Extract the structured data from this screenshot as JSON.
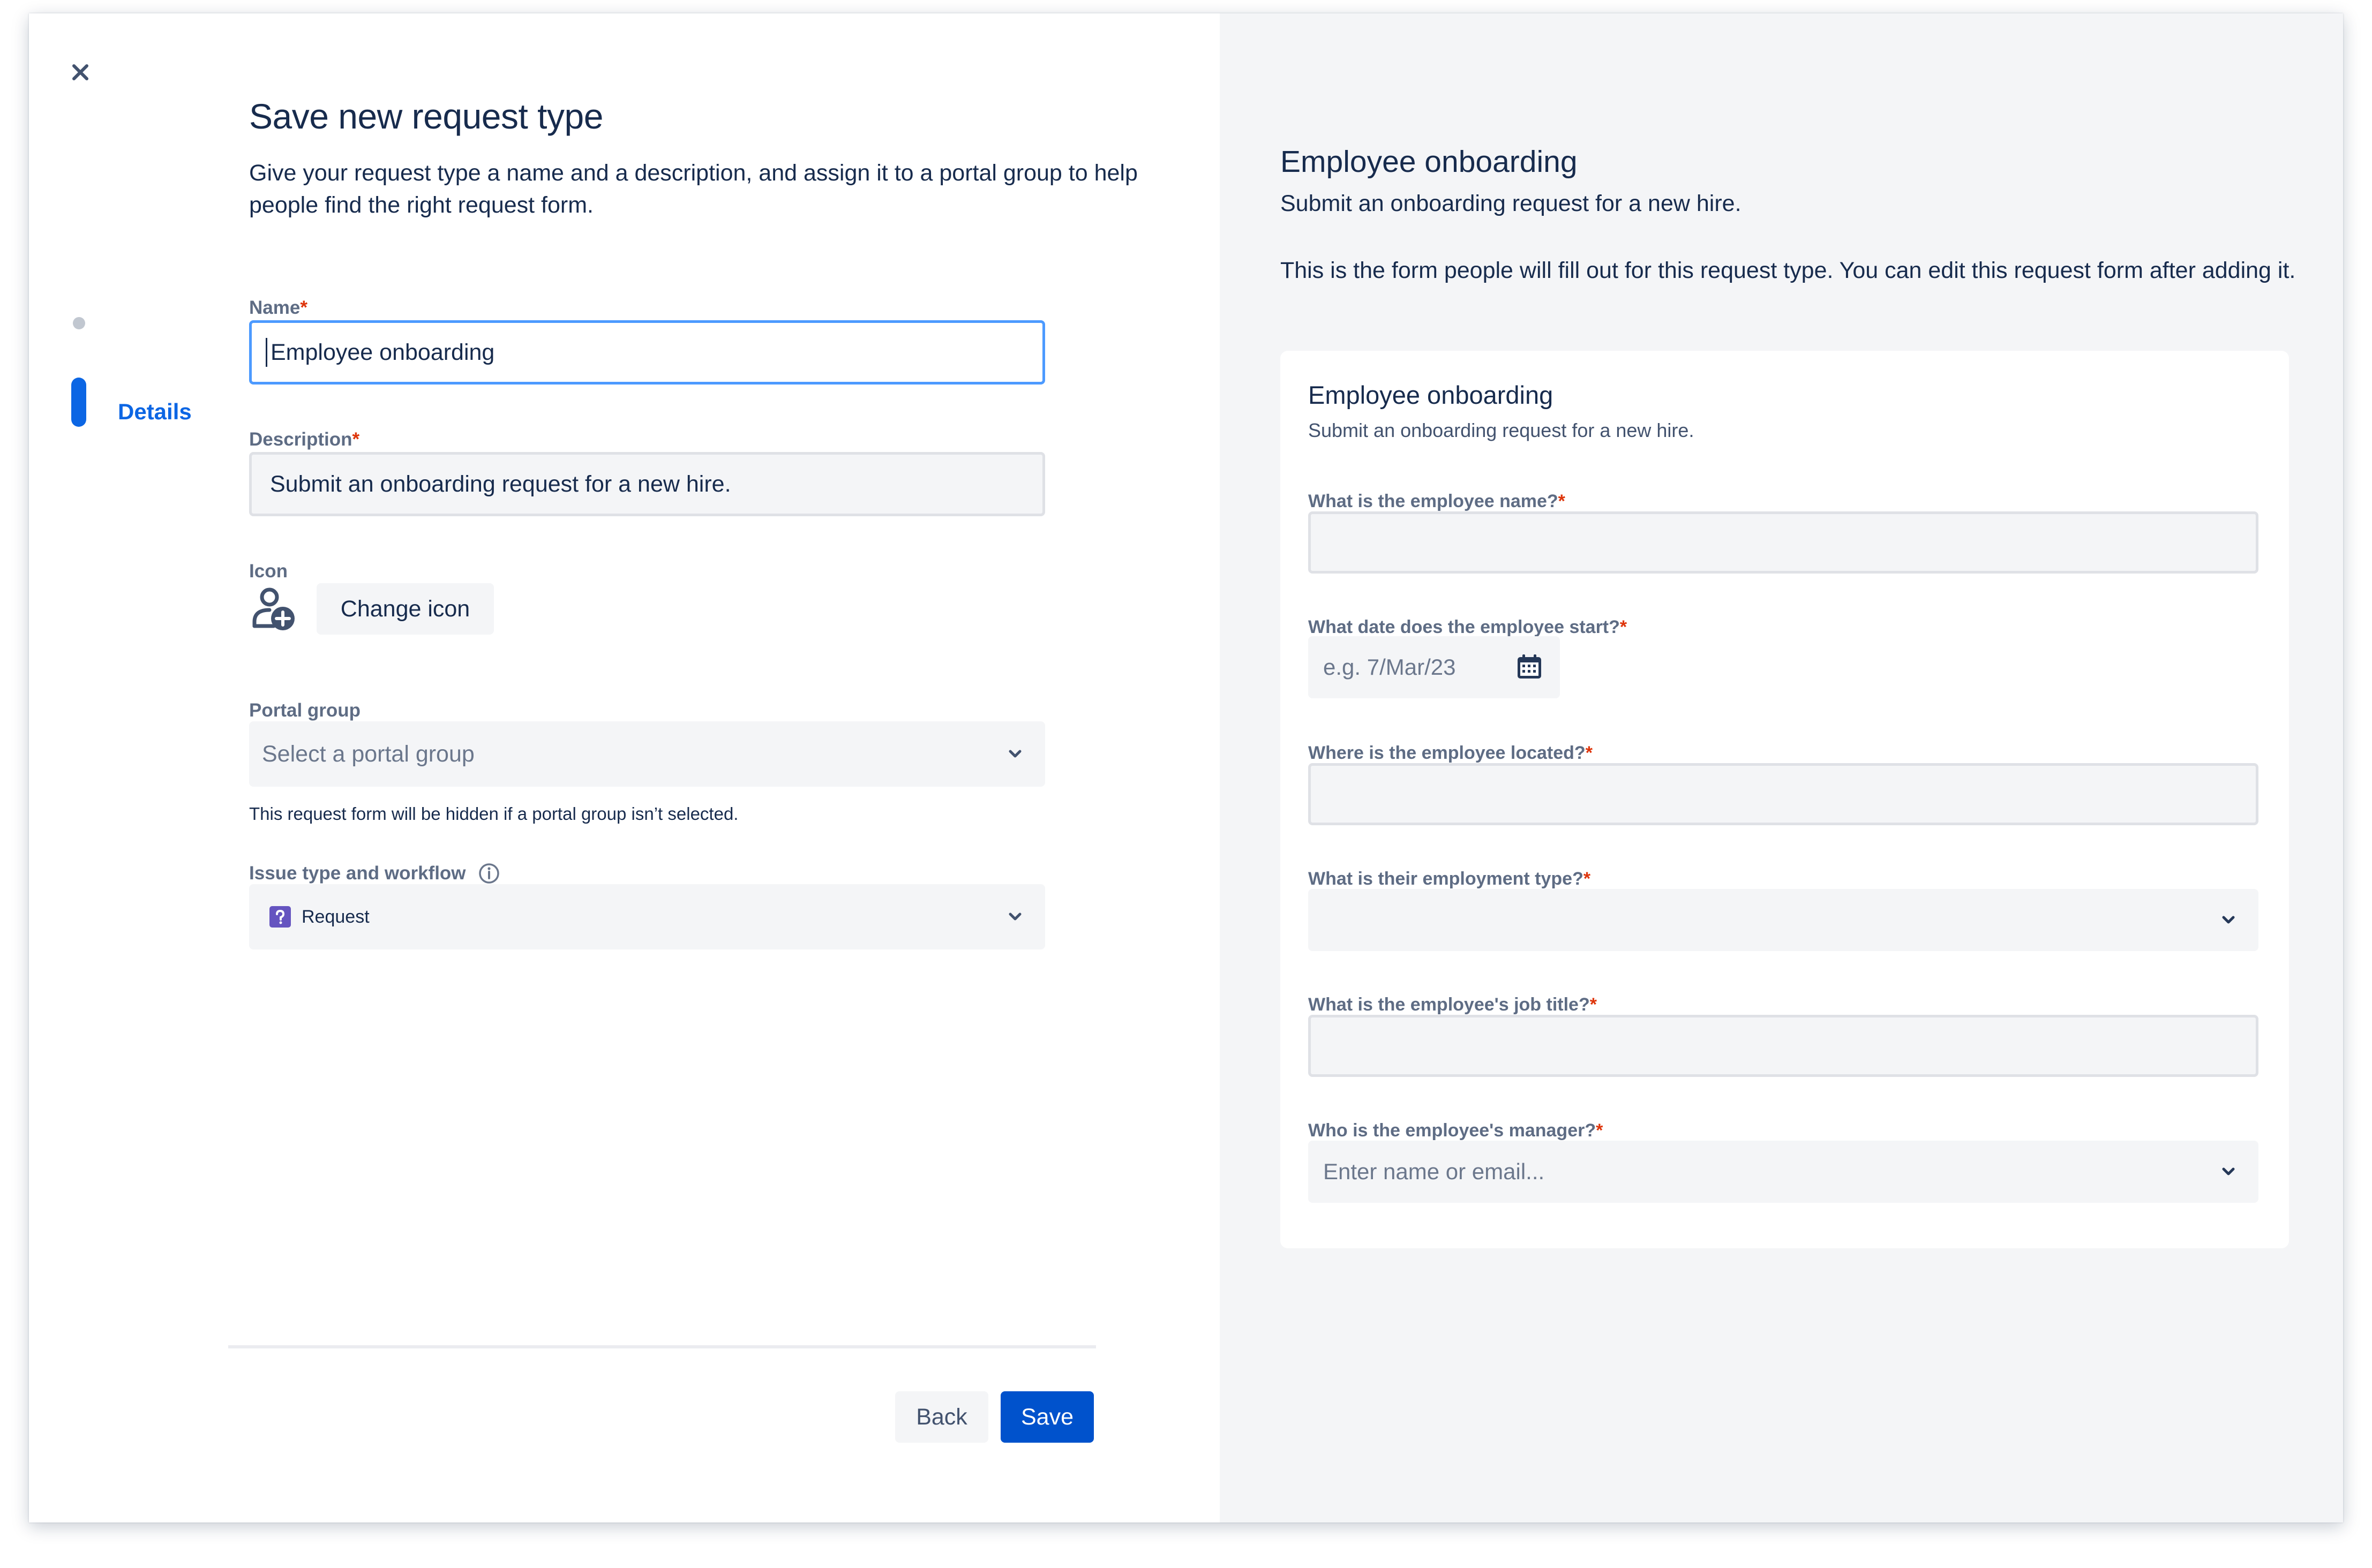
{
  "stepper": {
    "steps": [
      {
        "label": "",
        "state": "inactive"
      },
      {
        "label": "Details",
        "state": "active"
      }
    ]
  },
  "form": {
    "title": "Save new request type",
    "intro": "Give your request type a name and a description, and assign it to a portal group to help people find the right request form.",
    "name": {
      "label": "Name",
      "value": "Employee onboarding"
    },
    "description": {
      "label": "Description",
      "value": "Submit an onboarding request for a new hire."
    },
    "icon": {
      "label": "Icon",
      "icon_name": "person-add-icon",
      "change_label": "Change icon"
    },
    "portal_group": {
      "label": "Portal group",
      "placeholder": "Select a portal group",
      "help": "This request form will be hidden if a portal group isn’t selected."
    },
    "issue_type": {
      "label": "Issue type and workflow",
      "value": "Request",
      "icon_name": "question-square-icon"
    },
    "required_marker": "*"
  },
  "footer": {
    "back_label": "Back",
    "save_label": "Save"
  },
  "preview": {
    "title": "Employee onboarding",
    "subtitle": "Submit an onboarding request for a new hire.",
    "note": "This is the form people will fill out for this request type. You can edit this request form after adding it.",
    "card": {
      "title": "Employee onboarding",
      "subtitle": "Submit an onboarding request for a new hire.",
      "fields": [
        {
          "label": "What is the employee name?",
          "type": "text"
        },
        {
          "label": "What date does the employee start?",
          "type": "date",
          "placeholder": "e.g. 7/Mar/23"
        },
        {
          "label": "Where is the employee located?",
          "type": "text"
        },
        {
          "label": "What is their employment type?",
          "type": "select"
        },
        {
          "label": "What is the employee's job title?",
          "type": "text"
        },
        {
          "label": "Who is the employee's manager?",
          "type": "user-select",
          "placeholder": "Enter name or email..."
        }
      ]
    }
  },
  "colors": {
    "primary": "#0052cc",
    "step_active": "#0c66e4",
    "required": "#de350b",
    "focus_border": "#4c9aff",
    "issue_type_icon": "#6554c0",
    "panel_bg": "#f4f5f7"
  }
}
